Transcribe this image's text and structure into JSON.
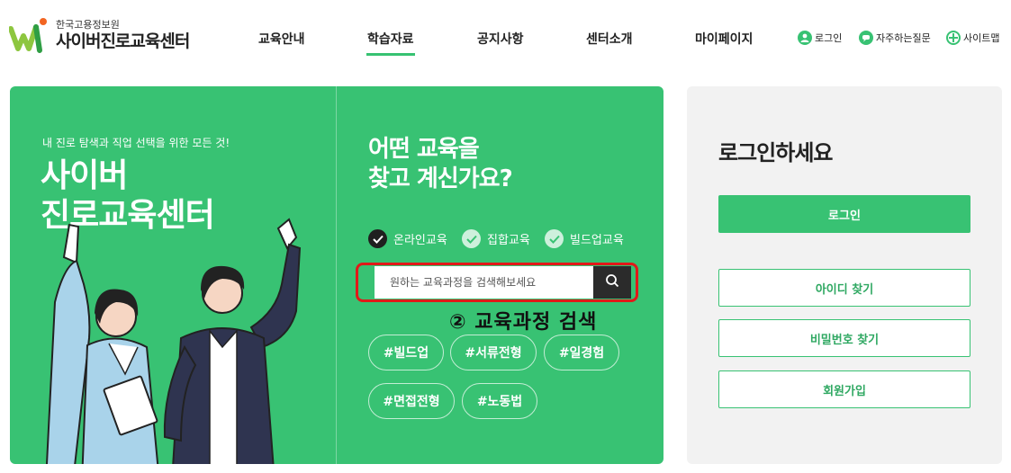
{
  "header": {
    "org": "한국고용정보원",
    "site_name": "사이버진로교육센터",
    "nav": [
      {
        "label": "교육안내"
      },
      {
        "label": "학습자료"
      },
      {
        "label": "공지사항"
      },
      {
        "label": "센터소개"
      },
      {
        "label": "마이페이지"
      }
    ],
    "util": [
      {
        "label": "로그인",
        "icon": "user-icon"
      },
      {
        "label": "자주하는질문",
        "icon": "chat-icon"
      },
      {
        "label": "사이트맵",
        "icon": "sitemap-icon"
      }
    ]
  },
  "hero": {
    "subtitle": "내 진로 탐색과 직업 선택을 위한 모든 것!",
    "title_line1": "사이버",
    "title_line2": "진로교육센터"
  },
  "finder": {
    "title_line1": "어떤 교육을",
    "title_line2": "찾고 계신가요?",
    "options": [
      {
        "label": "온라인교육",
        "checked": true
      },
      {
        "label": "집합교육",
        "checked": false
      },
      {
        "label": "빌드업교육",
        "checked": false
      }
    ],
    "search_placeholder": "원하는 교육과정을 검색해보세요",
    "annotation": "② 교육과정 검색",
    "tags": [
      "#빌드업",
      "#서류전형",
      "#일경험",
      "#면접전형",
      "#노동법"
    ]
  },
  "login": {
    "title": "로그인하세요",
    "login_button": "로그인",
    "find_id": "아이디 찾기",
    "find_pw": "비밀번호 찾기",
    "signup": "회원가입"
  },
  "colors": {
    "brand_green": "#38c273",
    "highlight_red": "#e11919"
  }
}
